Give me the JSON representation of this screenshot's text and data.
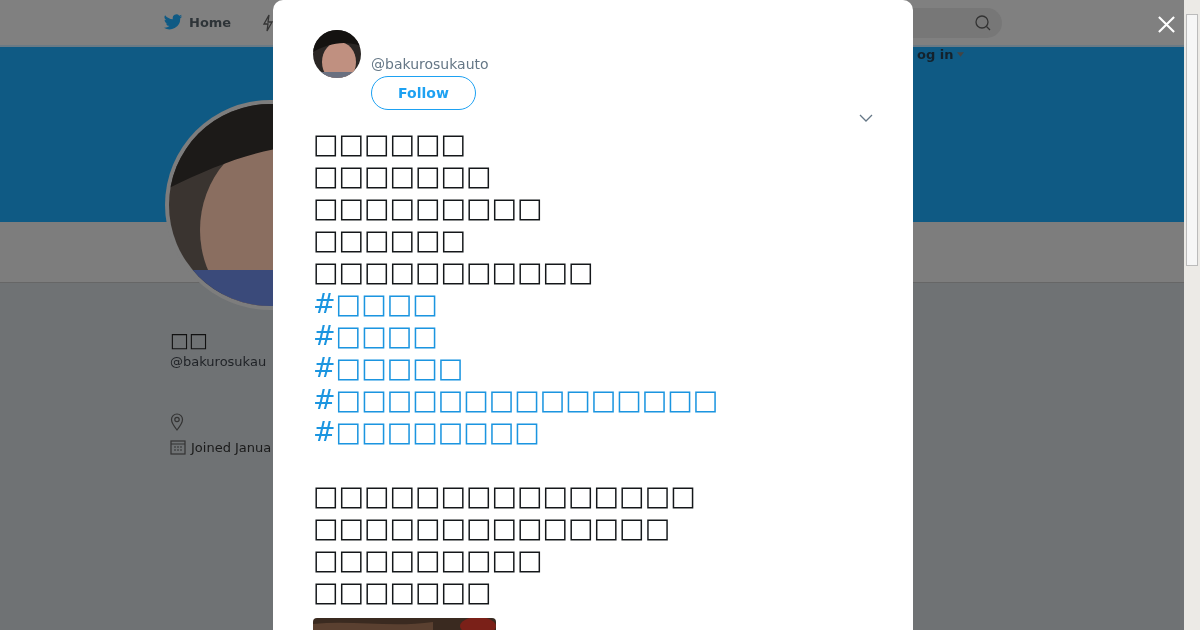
{
  "nav": {
    "home": "Home",
    "login": "og in"
  },
  "profile": {
    "name": "□□",
    "handle": "@bakurosukau",
    "joined": "Joined Janua"
  },
  "tweet": {
    "handle": "@bakurosukauto",
    "follow": "Follow",
    "lines": [
      "□□□□□□",
      "□□□□□□□",
      "□□□□□□□□□",
      "□□□□□□",
      "□□□□□□□□□□□"
    ],
    "hashtags": [
      "#□□□□",
      "#□□□□",
      "#□□□□□",
      "#□□□□□□□□□□□□□□□",
      "#□□□□□□□□"
    ],
    "lines_after": [
      "□□□□□□□□□□□□□□□",
      "□□□□□□□□□□□□□□",
      "□□□□□□□□□",
      "□□□□□□□"
    ],
    "media": {
      "kind": "picture"
    }
  }
}
